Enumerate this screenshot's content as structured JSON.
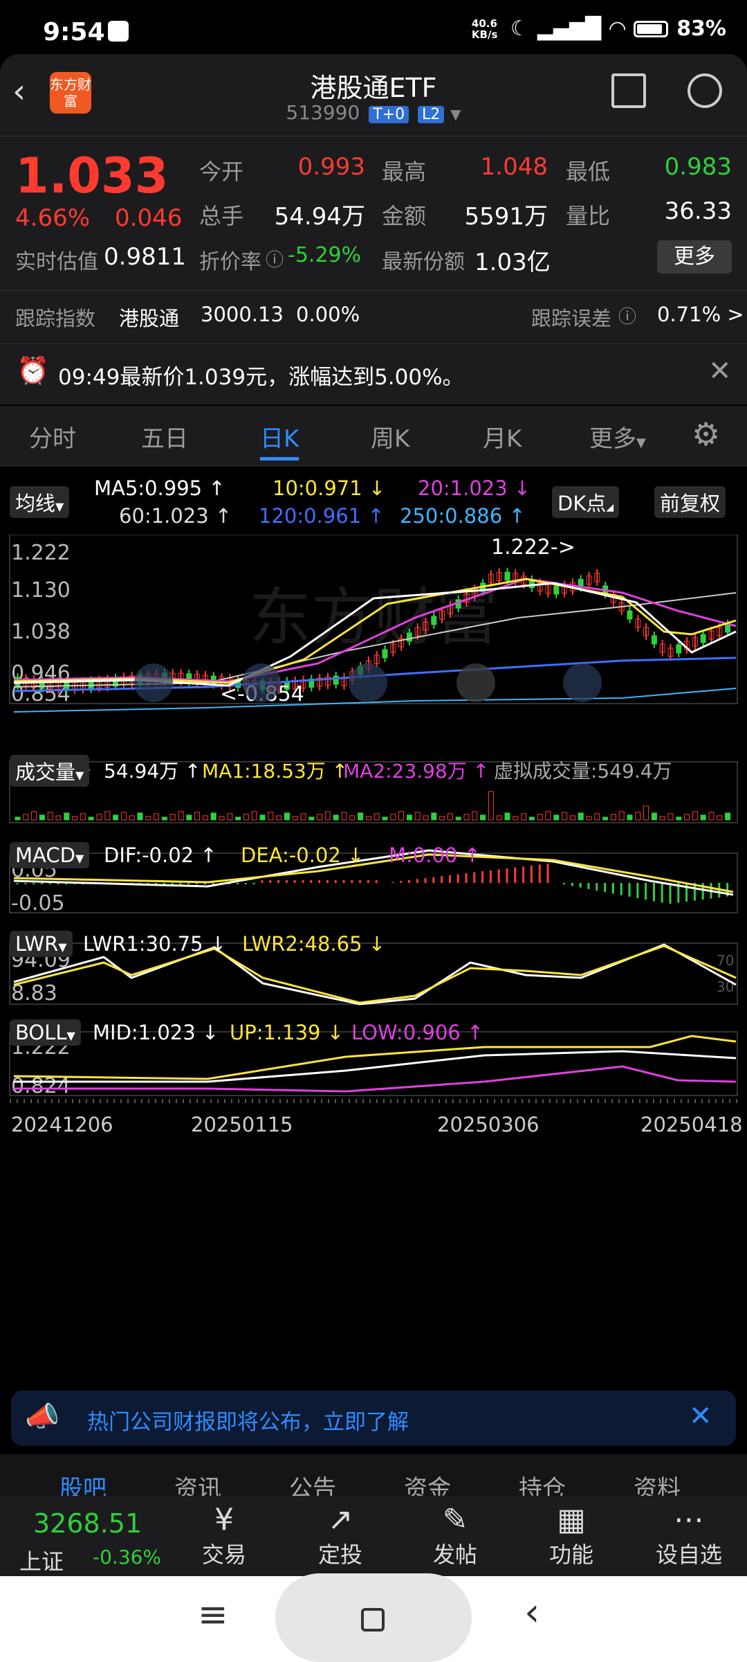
{
  "status": {
    "time": "9:54",
    "net_speed": "40.6 KB/s",
    "battery": "83%"
  },
  "header": {
    "title": "港股通ETF",
    "code": "513990",
    "tag1": "T+0",
    "tag2": "L2",
    "logo": "东方财富"
  },
  "quote": {
    "price": "1.033",
    "change_pct": "4.66%",
    "change": "0.046",
    "open_label": "今开",
    "open": "0.993",
    "high_label": "最高",
    "high": "1.048",
    "low_label": "最低",
    "low": "0.983",
    "volume_label": "总手",
    "volume": "54.94万",
    "amount_label": "金额",
    "amount": "5591万",
    "ratio_label": "量比",
    "ratio": "36.33",
    "iopv_label": "实时估值",
    "iopv": "0.9811",
    "discount_label": "折价率",
    "discount": "-5.29%",
    "shares_label": "最新份额",
    "shares": "1.03亿",
    "more_button": "更多",
    "track_label": "跟踪指数",
    "track_name": "港股通",
    "track_value": "3000.13",
    "track_pct": "0.00%",
    "error_label": "跟踪误差",
    "error_value": "0.71% >"
  },
  "alert": {
    "text": "09:49最新价1.039元，涨幅达到5.00%。"
  },
  "tabs": [
    "分时",
    "五日",
    "日K",
    "周K",
    "月K",
    "更多"
  ],
  "active_tab": "日K",
  "ma": {
    "selector": "均线",
    "ma5": "MA5:0.995 ↑",
    "ma10": "10:0.971 ↓",
    "ma20": "20:1.023 ↓",
    "ma60": "60:1.023 ↑",
    "ma120": "120:0.961 ↑",
    "ma250": "250:0.886 ↑",
    "dk_button": "DK点",
    "fq_button": "前复权",
    "y_labels": [
      "1.222",
      "1.130",
      "1.038",
      "0.946",
      "0.854"
    ],
    "high_note": "1.222->",
    "low_note": "<-0.854"
  },
  "volume": {
    "selector": "成交量",
    "value": "54.94万 ↑",
    "ma1": "MA1:18.53万 ↑",
    "ma2": "MA2:23.98万 ↑",
    "virtual": "虚拟成交量:549.4万",
    "y_label": "549.4万"
  },
  "macd": {
    "selector": "MACD",
    "dif": "DIF:-0.02 ↑",
    "dea": "DEA:-0.02 ↓",
    "m": "M:0.00 ↑",
    "y_top": "0.05",
    "y_bottom": "-0.05"
  },
  "lwr": {
    "selector": "LWR",
    "lwr1": "LWR1:30.75 ↓",
    "lwr2": "LWR2:48.65 ↓",
    "y_top": "94.09",
    "y_bottom": "8.83",
    "r70": "70",
    "r30": "30"
  },
  "boll": {
    "selector": "BOLL",
    "mid": "MID:1.023 ↓",
    "up": "UP:1.139 ↓",
    "low": "LOW:0.906 ↑",
    "y_top": "1.222",
    "y_bottom": "0.824"
  },
  "dates": [
    "20241206",
    "20250115",
    "20250306",
    "20250418"
  ],
  "ad": {
    "text": "热门公司财报即将公布，立即了解"
  },
  "bottom_tabs": [
    "股吧",
    "资讯",
    "公告",
    "资金",
    "持仓",
    "资料"
  ],
  "index": {
    "value": "3268.51",
    "name": "上证",
    "pct": "-0.36%"
  },
  "nav": [
    {
      "label": "交易",
      "icon": "¥"
    },
    {
      "label": "定投",
      "icon": "↗"
    },
    {
      "label": "发帖",
      "icon": "✎"
    },
    {
      "label": "功能",
      "icon": "▦"
    },
    {
      "label": "设自选",
      "icon": "⋯"
    }
  ],
  "colors": {
    "up": "#ff3b30",
    "down": "#2fd13a",
    "accent": "#2f8cff",
    "ma5": "#ffffff",
    "ma10": "#ffe53b",
    "ma20": "#e040e0",
    "ma120": "#3f6fff",
    "ma250": "#3fb6ff"
  }
}
